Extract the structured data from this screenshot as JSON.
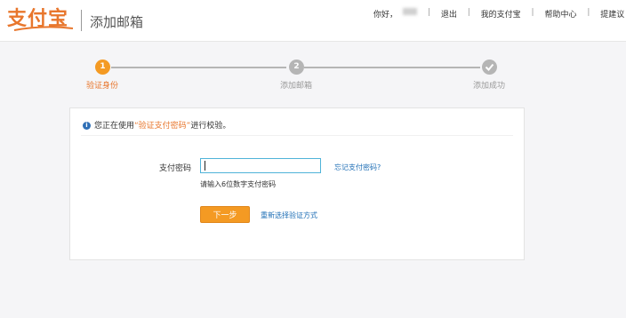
{
  "header": {
    "logo_text": "支付宝",
    "page_title": "添加邮箱",
    "nav": {
      "greeting": "你好，",
      "logout": "退出",
      "my_alipay": "我的支付宝",
      "help": "帮助中心",
      "suggest": "提建议"
    }
  },
  "steps": [
    {
      "number": "1",
      "label": "验证身份",
      "state": "active"
    },
    {
      "number": "2",
      "label": "添加邮箱",
      "state": "pending"
    },
    {
      "number": "check",
      "label": "添加成功",
      "state": "pending"
    }
  ],
  "panel": {
    "notice_prefix": "您正在使用",
    "notice_highlight": "“验证支付密码”",
    "notice_suffix": "进行校验。",
    "field_label": "支付密码",
    "input_value": "",
    "forgot_link": "忘记支付密码?",
    "hint": "请输入6位数字支付密码",
    "next_button": "下一步",
    "rechoose_link": "重新选择验证方式"
  },
  "colors": {
    "accent": "#f49a23",
    "brand": "#e8762c",
    "link": "#1f6fb6",
    "inactive": "#b5b5b5",
    "info": "#2f6fb6"
  }
}
